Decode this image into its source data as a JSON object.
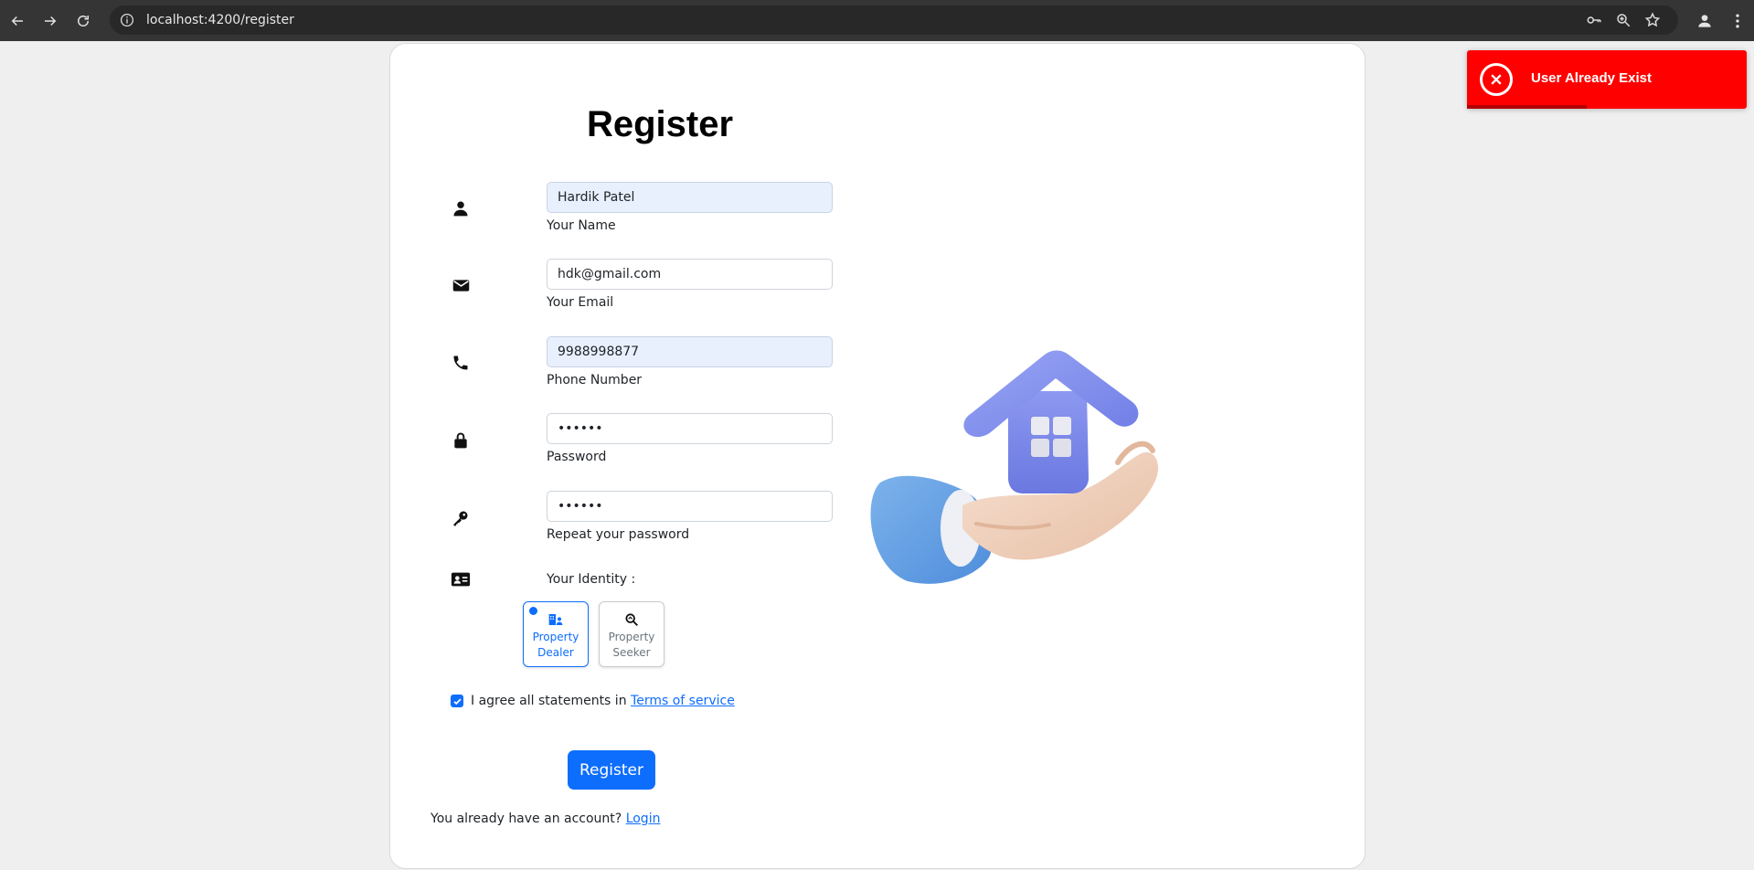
{
  "browser": {
    "url": "localhost:4200/register",
    "icons": [
      "back-icon",
      "forward-icon",
      "reload-icon",
      "info-icon",
      "key-icon",
      "zoom-icon",
      "star-icon",
      "profile-icon",
      "menu-icon"
    ]
  },
  "form": {
    "title": "Register",
    "name": {
      "value": "Hardik Patel",
      "label": "Your Name"
    },
    "email": {
      "value": "hdk@gmail.com",
      "label": "Your Email"
    },
    "phone": {
      "value": "9988998877",
      "label": "Phone Number"
    },
    "password": {
      "value": "••••••",
      "label": "Password"
    },
    "repeat_password": {
      "value": "••••••",
      "label": "Repeat your password"
    },
    "identity_label": "Your Identity :",
    "identity_options": [
      {
        "line1": "Property",
        "line2": "Dealer",
        "selected": true
      },
      {
        "line1": "Property",
        "line2": "Seeker",
        "selected": false
      }
    ],
    "agree_text": "I agree all statements in",
    "terms_link": "Terms of service",
    "agree_checked": true,
    "register_button": "Register",
    "login_prompt": "You already have an account?",
    "login_link": "Login"
  },
  "toast": {
    "message": "User Already Exist",
    "color": "#ff0000"
  },
  "colors": {
    "accent": "#0d6efd",
    "autofill": "#e8f0fe"
  }
}
